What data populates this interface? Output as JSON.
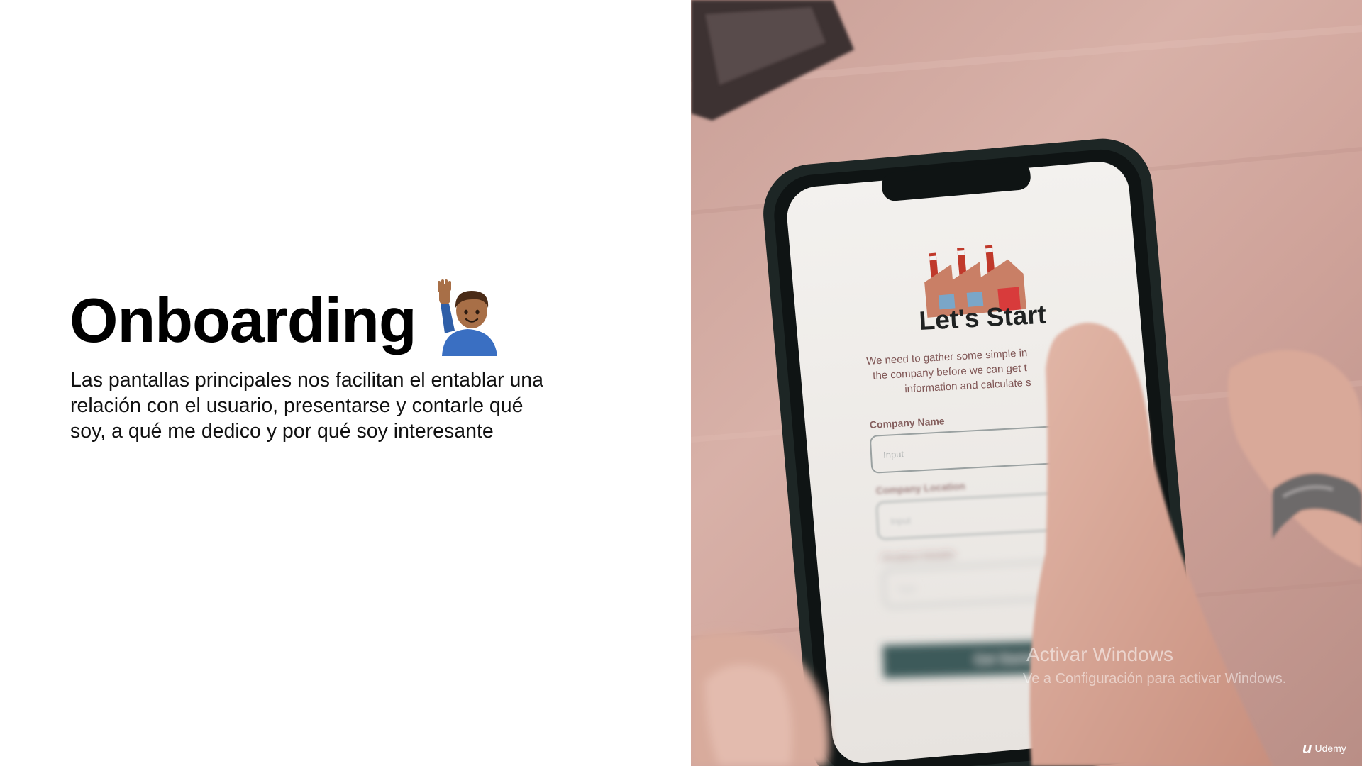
{
  "slide": {
    "title": "Onboarding",
    "body_lines": [
      "Las pantallas principales nos facilitan el entablar una",
      "relación con el usuario, presentarse y contarle qué",
      "soy, a qué me dedico y por qué soy interesante"
    ]
  },
  "phone_screen": {
    "heading": "Let's Start",
    "intro_lines": [
      "We need to gather some simple in",
      "the company before we can get t",
      "information and calculate s"
    ],
    "field_1_label": "Company Name",
    "field_1_placeholder": "Input",
    "field_2_label": "Company Location",
    "field_2_placeholder": "Input",
    "field_3_label": "Product Details",
    "field_3_placeholder": "Type",
    "button_label": "Get Started"
  },
  "watermark": {
    "line1": "Activar Windows",
    "line2": "Ve a Configuración para activar Windows."
  },
  "brand": {
    "name": "Udemy"
  },
  "colors": {
    "title": "#000000",
    "phone_button": "#3c5a5a",
    "table_pink": "#d2a69e"
  }
}
